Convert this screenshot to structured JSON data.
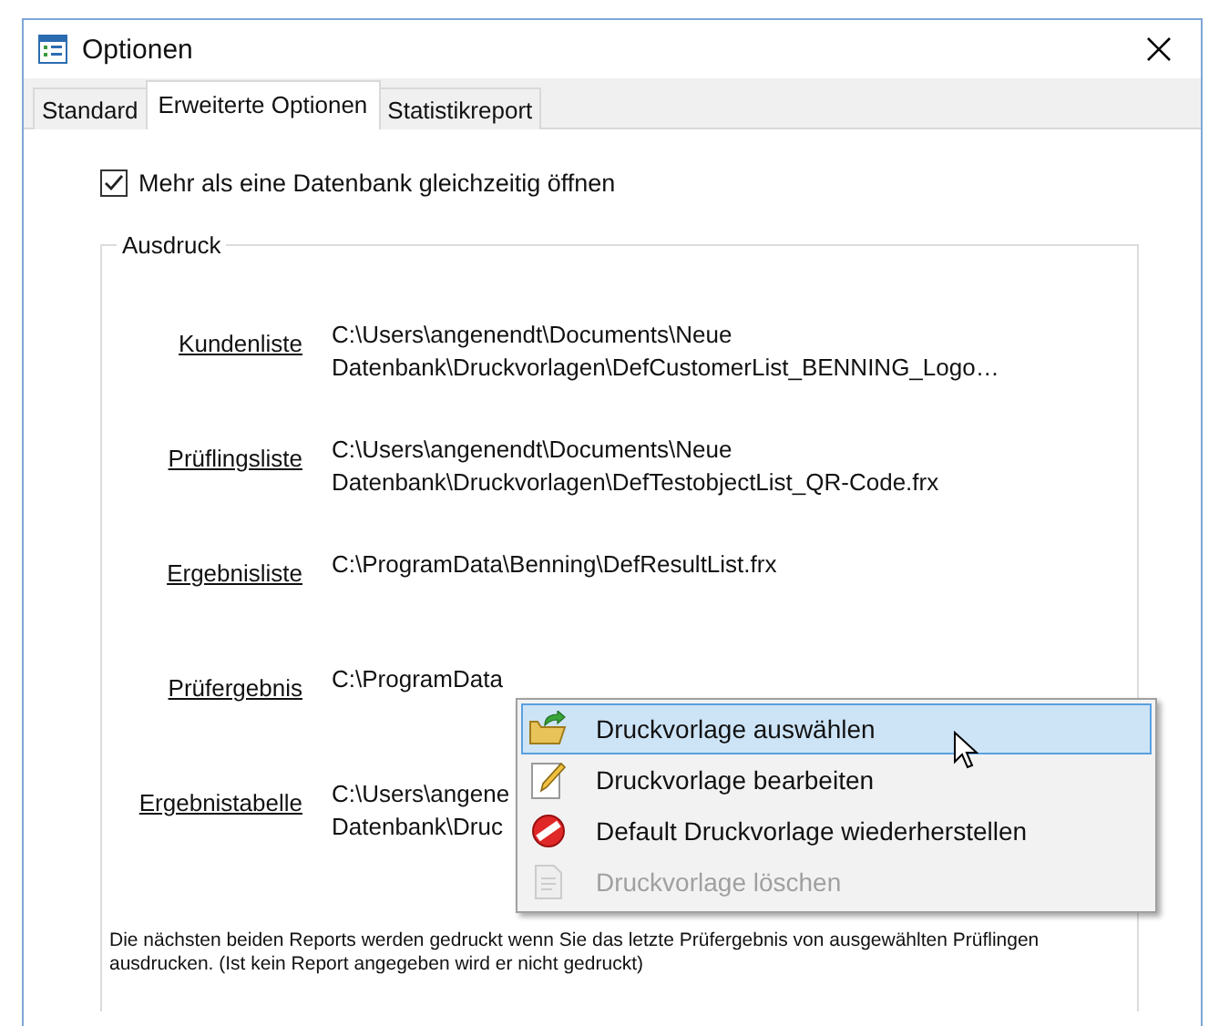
{
  "window": {
    "title": "Optionen"
  },
  "tabs": [
    {
      "label": "Standard",
      "selected": false
    },
    {
      "label": "Erweiterte Optionen",
      "selected": true
    },
    {
      "label": "Statistikreport",
      "selected": false
    }
  ],
  "multi_db": {
    "label": "Mehr als eine Datenbank gleichzeitig öffnen",
    "checked": true
  },
  "print_group": {
    "title": "Ausdruck",
    "reports": [
      {
        "label": "Kundenliste",
        "path": [
          "C:\\Users\\angenendt\\Documents\\Neue",
          "Datenbank\\Druckvorlagen\\DefCustomerList_BENNING_Logo…"
        ]
      },
      {
        "label": "Prüflingsliste",
        "path": [
          "C:\\Users\\angenendt\\Documents\\Neue",
          "Datenbank\\Druckvorlagen\\DefTestobjectList_QR-Code.frx"
        ]
      },
      {
        "label": "Ergebnisliste",
        "path": [
          "C:\\ProgramData\\Benning\\DefResultList.frx"
        ]
      },
      {
        "label": "Prüfergebnis",
        "path": [
          "C:\\ProgramData"
        ]
      },
      {
        "label": "Ergebnistabelle",
        "path": [
          "C:\\Users\\angene",
          "Datenbank\\Druc"
        ]
      }
    ],
    "note": "Die nächsten beiden Reports werden gedruckt wenn Sie das letzte Prüfergebnis von ausgewählten Prüflingen ausdrucken. (Ist kein Report angegeben wird er nicht gedruckt)"
  },
  "context_menu": {
    "items": [
      {
        "kind": "select",
        "label": "Druckvorlage auswählen",
        "selected": true,
        "disabled": false
      },
      {
        "kind": "edit",
        "label": "Druckvorlage bearbeiten",
        "selected": false,
        "disabled": false
      },
      {
        "kind": "reset",
        "label": "Default Druckvorlage wiederherstellen",
        "selected": false,
        "disabled": false
      },
      {
        "kind": "delete",
        "label": "Druckvorlage löschen",
        "selected": false,
        "disabled": true
      }
    ]
  }
}
